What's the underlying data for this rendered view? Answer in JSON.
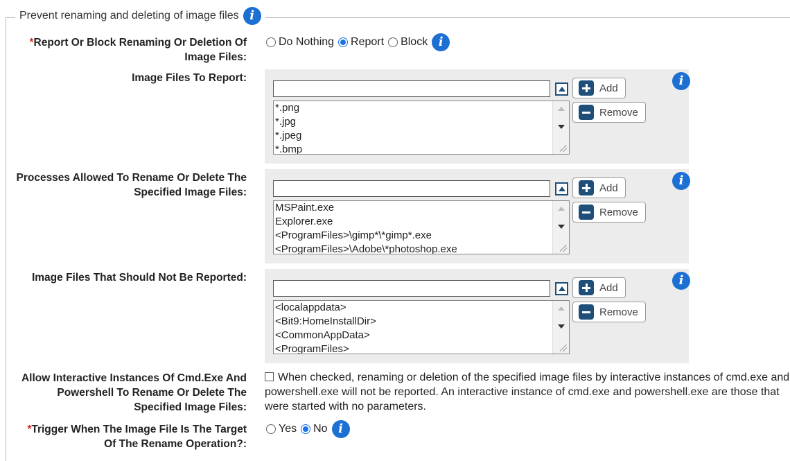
{
  "section": {
    "title": "Prevent renaming and deleting of image files"
  },
  "report_or_block": {
    "required_marker": "*",
    "label": "Report Or Block Renaming Or Deletion Of Image Files:",
    "options": [
      "Do Nothing",
      "Report",
      "Block"
    ],
    "selected": "Report"
  },
  "image_files_to_report": {
    "label": "Image Files To Report:",
    "input_value": "",
    "items": [
      "*.png",
      "*.jpg",
      "*.jpeg",
      "*.bmp"
    ],
    "add_label": "Add",
    "remove_label": "Remove"
  },
  "processes_allowed": {
    "label": "Processes Allowed To Rename Or Delete The Specified Image Files:",
    "input_value": "",
    "items": [
      "MSPaint.exe",
      "Explorer.exe",
      "<ProgramFiles>\\gimp*\\*gimp*.exe",
      "<ProgramFiles>\\Adobe\\*photoshop.exe"
    ],
    "add_label": "Add",
    "remove_label": "Remove"
  },
  "not_reported": {
    "label": "Image Files That Should Not Be Reported:",
    "input_value": "",
    "items": [
      "<localappdata>",
      "<Bit9:HomeInstallDir>",
      "<CommonAppData>",
      "<ProgramFiles>"
    ],
    "add_label": "Add",
    "remove_label": "Remove"
  },
  "interactive_instances": {
    "label": "Allow Interactive Instances Of Cmd.Exe And Powershell To Rename Or Delete The Specified Image Files:",
    "checked": false,
    "description": "When checked, renaming or deletion of the specified image files by interactive instances of cmd.exe and powershell.exe will not be reported. An interactive instance of cmd.exe and powershell.exe are those that were started with no parameters."
  },
  "trigger_target": {
    "required_marker": "*",
    "label": "Trigger When The Image File Is The Target Of The Rename Operation?:",
    "options": [
      "Yes",
      "No"
    ],
    "selected": "No"
  },
  "colors": {
    "accent": "#1a73e8",
    "info_icon": "#1c6fd3",
    "button_icon": "#1e4e7a",
    "required": "#d9251c",
    "panel_bg": "#ececec"
  }
}
